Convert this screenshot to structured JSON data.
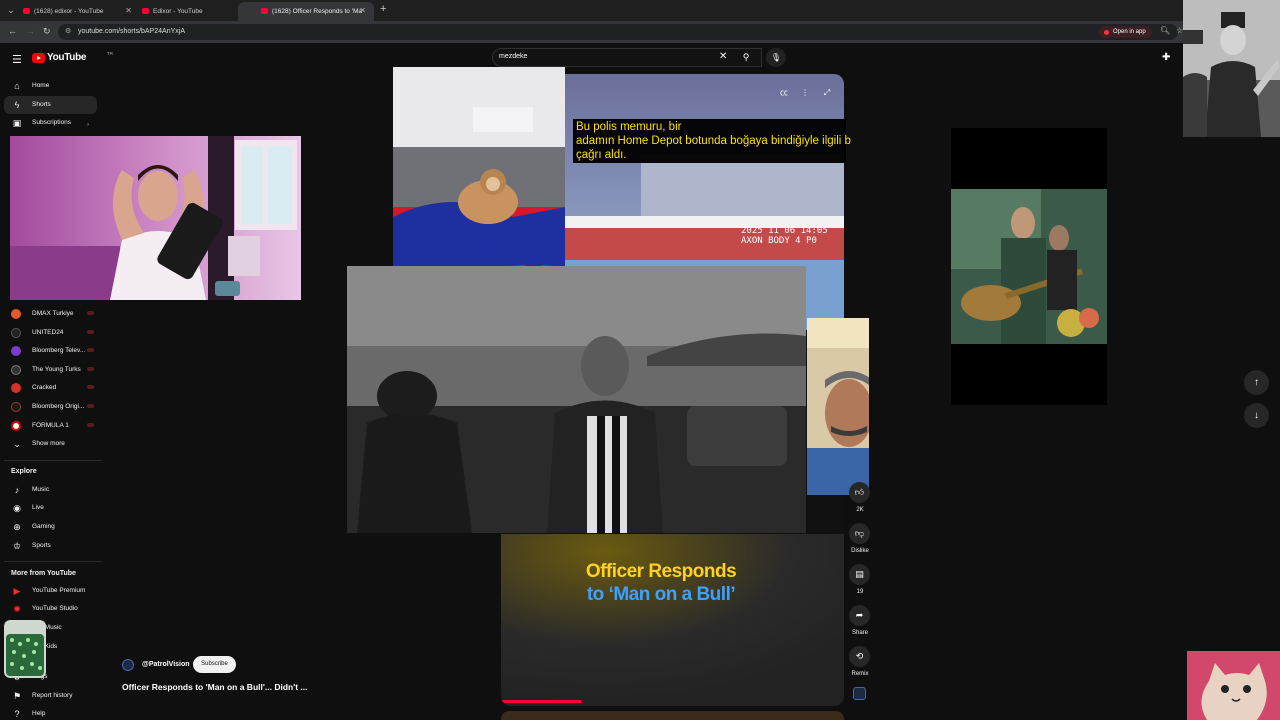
{
  "browser": {
    "tabs": [
      {
        "title": "(1628) edixor - YouTube",
        "active": false
      },
      {
        "title": "Edixor - YouTube",
        "active": false
      },
      {
        "title": "(1628) Officer Responds to 'Ma",
        "active": true
      }
    ],
    "url": "youtube.com/shorts/bAP24AnYxjA",
    "open_in_app": "Open in app"
  },
  "masthead": {
    "logo_text": "YouTube",
    "country_code": "TR",
    "search_value": "mezdeke"
  },
  "sidebar": {
    "main": [
      {
        "label": "Home",
        "icon": "home-icon"
      },
      {
        "label": "Shorts",
        "icon": "shorts-icon"
      },
      {
        "label": "Subscriptions",
        "icon": "subscriptions-icon"
      }
    ],
    "subscriptions": [
      {
        "label": "DMAX Turkiye",
        "color": "#e05a2a"
      },
      {
        "label": "UNITED24",
        "color": "#222222"
      },
      {
        "label": "Bloomberg Telev...",
        "color": "#7a3cc8"
      },
      {
        "label": "The Young Turks",
        "color": "#333333"
      },
      {
        "label": "Cracked",
        "color": "#d8302a"
      },
      {
        "label": "Bloomberg Origi...",
        "color": "#1a1a1a"
      },
      {
        "label": "FORMULA 1",
        "color": "#e10600"
      }
    ],
    "show_more": "Show more",
    "explore_heading": "Explore",
    "explore": [
      {
        "label": "Music",
        "icon": "music-icon"
      },
      {
        "label": "Live",
        "icon": "live-icon"
      },
      {
        "label": "Gaming",
        "icon": "gaming-icon"
      },
      {
        "label": "Sports",
        "icon": "sports-icon"
      }
    ],
    "more_heading": "More from YouTube",
    "more": [
      {
        "label": "YouTube Premium",
        "icon": "youtube-premium-icon"
      },
      {
        "label": "YouTube Studio",
        "icon": "youtube-studio-icon"
      },
      {
        "label": "ube Music",
        "icon": "youtube-music-icon"
      },
      {
        "label": "ube Kids",
        "icon": "youtube-kids-icon"
      }
    ],
    "footer": [
      {
        "label": "ttings",
        "icon": "settings-icon"
      },
      {
        "label": "Report history",
        "icon": "flag-icon"
      },
      {
        "label": "Help",
        "icon": "help-icon"
      }
    ]
  },
  "short": {
    "caption_lines": [
      "Bu polis memuru, bir",
      "adamın Home Depot botunda boğaya bindiğiyle ilgili b",
      "çağrı aldı."
    ],
    "bodycam_stamp_1": "2025 11 06 14:05",
    "bodycam_stamp_2": "AXON BODY 4 P0",
    "title_card_line1": "Officer Responds",
    "title_card_line2": "to ‘Man on a Bull’",
    "channel": "@PatrolVision",
    "subscribe_label": "Subscribe",
    "title": "Officer Responds to 'Man on a Bull'... Didn't ..."
  },
  "actions": [
    {
      "icon": "like-icon",
      "label": "2K"
    },
    {
      "icon": "dislike-icon",
      "label": "Dislike"
    },
    {
      "icon": "comments-icon",
      "label": "19"
    },
    {
      "icon": "share-icon",
      "label": "Share"
    },
    {
      "icon": "remix-icon",
      "label": "Remix"
    }
  ],
  "colors": {
    "brand_red": "#ff0000",
    "caption_yellow": "#ffe000",
    "title_yellow": "#ffd21f",
    "title_blue": "#3aa3ff"
  }
}
